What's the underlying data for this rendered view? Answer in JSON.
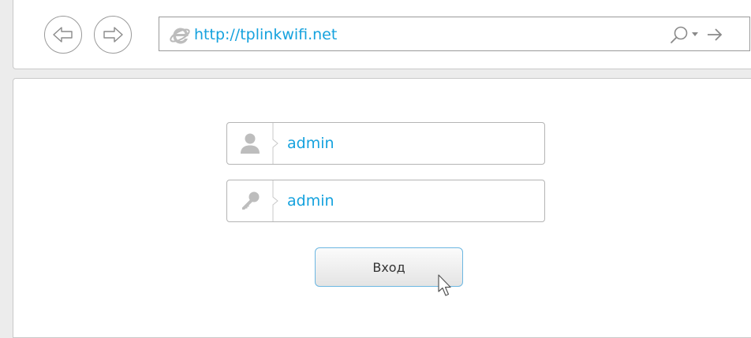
{
  "browser": {
    "url": "http://tplinkwifi.net",
    "icons": {
      "back": "back-arrow-icon",
      "forward": "forward-arrow-icon",
      "browser": "internet-explorer-icon",
      "search": "search-icon",
      "dropdown": "chevron-down-icon",
      "go": "go-arrow-icon"
    }
  },
  "login": {
    "username_value": "admin",
    "password_value": "admin",
    "submit_label": "Вход",
    "icons": {
      "username": "user-icon",
      "password": "key-icon"
    }
  },
  "colors": {
    "accent": "#15a2de",
    "button_border": "#6cb7e2",
    "frame": "#ececec"
  }
}
